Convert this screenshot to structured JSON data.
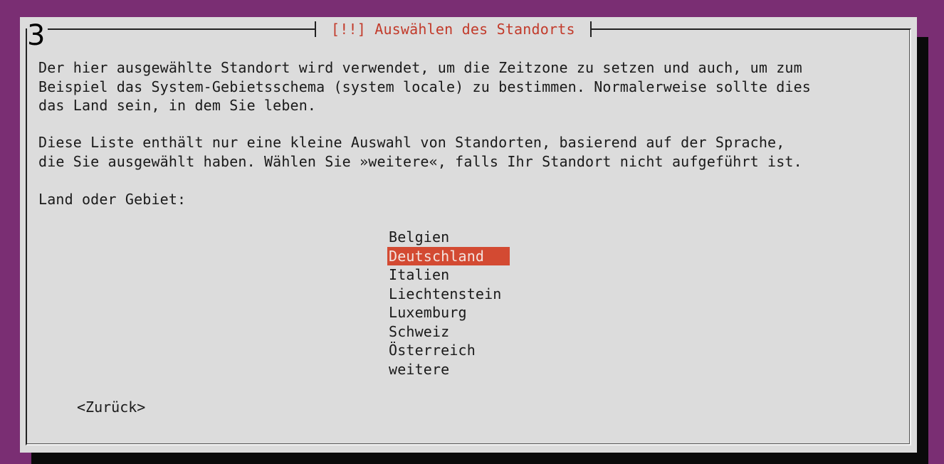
{
  "dialog": {
    "step_number": "3",
    "title": "[!!] Auswählen des Standorts",
    "paragraph1": "Der hier ausgewählte Standort wird verwendet, um die Zeitzone zu setzen und auch, um zum\nBeispiel das System-Gebietsschema (system locale) zu bestimmen. Normalerweise sollte dies\ndas Land sein, in dem Sie leben.",
    "paragraph2": "Diese Liste enthält nur eine kleine Auswahl von Standorten, basierend auf der Sprache,\ndie Sie ausgewählt haben. Wählen Sie »weitere«, falls Ihr Standort nicht aufgeführt ist.",
    "prompt": "Land oder Gebiet:",
    "selected": "Deutschland",
    "options": [
      "Belgien",
      "Deutschland",
      "Italien",
      "Liechtenstein",
      "Luxemburg",
      "Schweiz",
      "Österreich",
      "weitere"
    ],
    "back_label": "<Zurück>"
  },
  "colors": {
    "desktop_background": "#7a2e73",
    "dialog_background": "#dcdcdc",
    "title_text": "#c23a2a",
    "selection_highlight": "#d34a32",
    "shadow": "#0a0a0a"
  }
}
